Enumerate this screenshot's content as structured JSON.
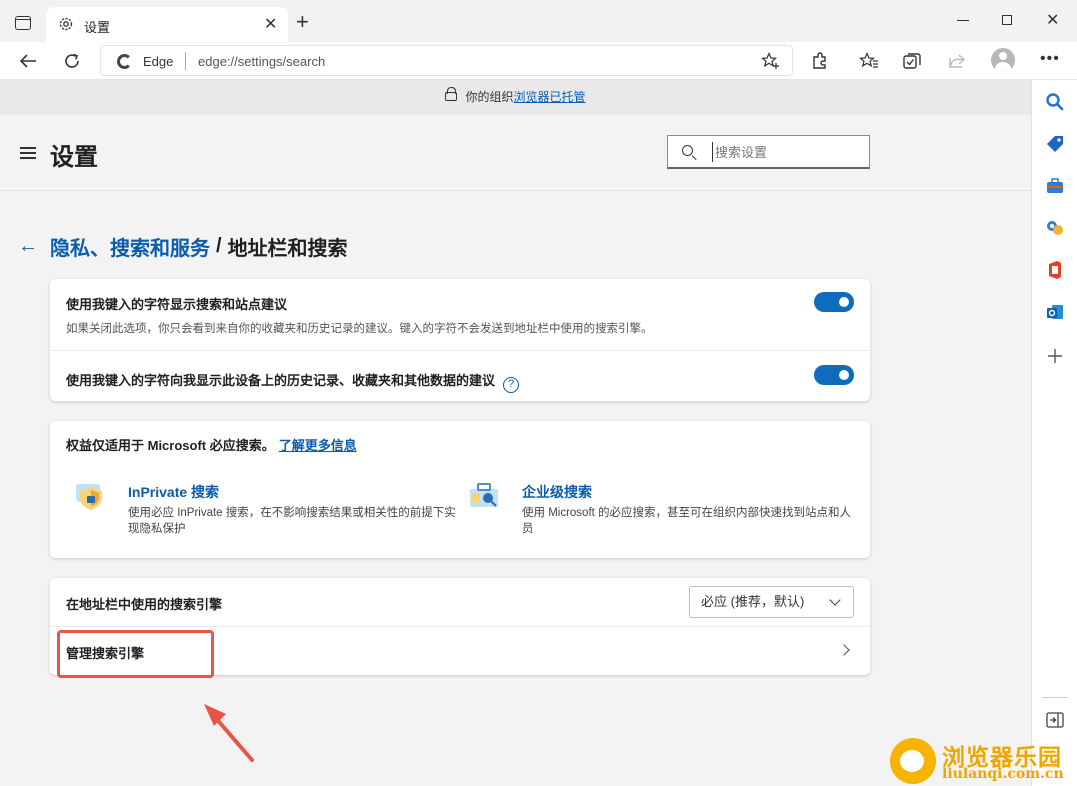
{
  "tab": {
    "title": "设置"
  },
  "address_bar": {
    "identity_label": "Edge",
    "url": "edge://settings/search"
  },
  "banner": {
    "prefix": "你的组织",
    "link": "浏览器已托管"
  },
  "settings_header": {
    "title": "设置",
    "search_placeholder": "搜索设置"
  },
  "breadcrumb": {
    "parent": "隐私、搜索和服务",
    "separator": "/",
    "current": "地址栏和搜索"
  },
  "suggestions_card": {
    "row1_title": "使用我键入的字符显示搜索和站点建议",
    "row1_desc": "如果关闭此选项，你只会看到来自你的收藏夹和历史记录的建议。键入的字符不会发送到地址栏中使用的搜索引擎。",
    "row1_toggle_on": true,
    "row2_title": "使用我键入的字符向我显示此设备上的历史记录、收藏夹和其他数据的建议",
    "row2_help": "?",
    "row2_toggle_on": true
  },
  "benefits_card": {
    "heading": "权益仅适用于 Microsoft 必应搜索。",
    "learn_more": "了解更多信息",
    "features": [
      {
        "title": "InPrivate 搜索",
        "desc": "使用必应 InPrivate 搜索，在不影响搜索结果或相关性的前提下实现隐私保护"
      },
      {
        "title": "企业级搜索",
        "desc": "使用 Microsoft 的必应搜索，甚至可在组织内部快速找到站点和人员"
      }
    ]
  },
  "engine_card": {
    "label": "在地址栏中使用的搜索引擎",
    "selected_engine": "必应 (推荐，默认)",
    "manage_label": "管理搜索引擎"
  },
  "watermark": {
    "cn": "浏览器乐园",
    "en": "liulanqi.com.cn"
  },
  "colors": {
    "accent": "#0f6cbd",
    "link": "#0b5cad",
    "highlight": "#e8534a"
  }
}
